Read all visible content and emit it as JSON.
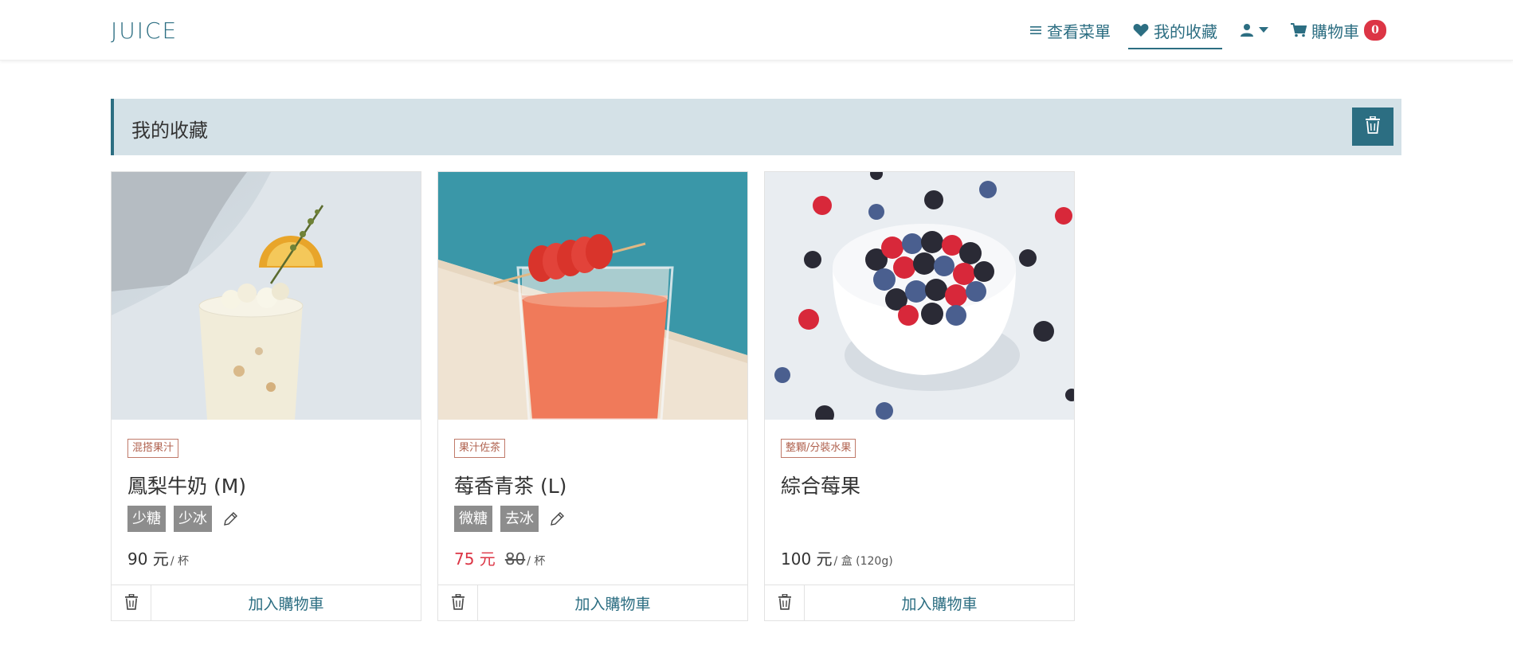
{
  "navbar": {
    "logo": "JUICE",
    "menu_label": "查看菜單",
    "favorites_label": "我的收藏",
    "cart_label": "購物車",
    "cart_count": "0",
    "icons": [
      "menu-icon",
      "heart-icon",
      "user-icon",
      "caret-down-icon",
      "cart-icon"
    ]
  },
  "section": {
    "title": "我的收藏"
  },
  "colors": {
    "brand": "#2c6e82",
    "header_bg": "#d4e1e7",
    "sale_red": "#dc3545",
    "tag_border": "#c07a6a",
    "option_gray": "#8d8d8d"
  },
  "products": [
    {
      "tag": "混搭果汁",
      "name": "鳳梨牛奶 (M)",
      "options": [
        "少糖",
        "少冰"
      ],
      "price": "90 元",
      "unit": "/ 杯",
      "add_label": "加入購物車"
    },
    {
      "tag": "果汁佐茶",
      "name": "莓香青茶 (L)",
      "options": [
        "微糖",
        "去冰"
      ],
      "sale_price": "75 元",
      "original_price": "80",
      "unit": "/ 杯",
      "add_label": "加入購物車"
    },
    {
      "tag": "整顆/分裝水果",
      "name": "綜合莓果",
      "options": [],
      "price": "100 元",
      "unit": "/ 盒 (120g)",
      "add_label": "加入購物車"
    }
  ]
}
